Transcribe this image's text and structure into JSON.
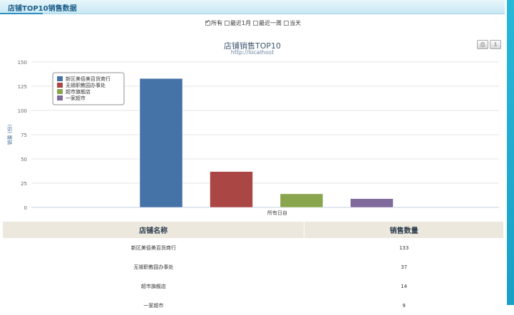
{
  "panel": {
    "title": "店铺TOP10销售数据"
  },
  "filters": [
    {
      "label": "所有",
      "checked": true
    },
    {
      "label": "最近1月",
      "checked": false
    },
    {
      "label": "最近一周",
      "checked": false
    },
    {
      "label": "当天",
      "checked": false
    }
  ],
  "toolbar": {
    "print_icon": "print-icon",
    "export_icon": "download-icon"
  },
  "chart_data": {
    "type": "bar",
    "title": "店铺销售TOP10",
    "subtitle": "http://localhost",
    "ylabel": "销量 (份)",
    "ylim": [
      0,
      150
    ],
    "yticks": [
      0,
      25,
      50,
      75,
      100,
      125,
      150
    ],
    "categories": [
      "所有日自"
    ],
    "series": [
      {
        "name": "新区美佰美百货商行",
        "values": [
          133
        ],
        "color": "#4572a7"
      },
      {
        "name": "无锡职教园办事处",
        "values": [
          37
        ],
        "color": "#aa4643"
      },
      {
        "name": "超市旗舰店",
        "values": [
          14
        ],
        "color": "#89a54e"
      },
      {
        "name": "一家超市",
        "values": [
          9
        ],
        "color": "#80699b"
      }
    ],
    "legend": "top-left",
    "grid": true
  },
  "table": {
    "headers": [
      "店铺名称",
      "销售数量"
    ],
    "rows": [
      [
        "新区美佰美百货商行",
        "133"
      ],
      [
        "无锡职教园办事处",
        "37"
      ],
      [
        "超市旗舰店",
        "14"
      ],
      [
        "一家超市",
        "9"
      ]
    ]
  }
}
